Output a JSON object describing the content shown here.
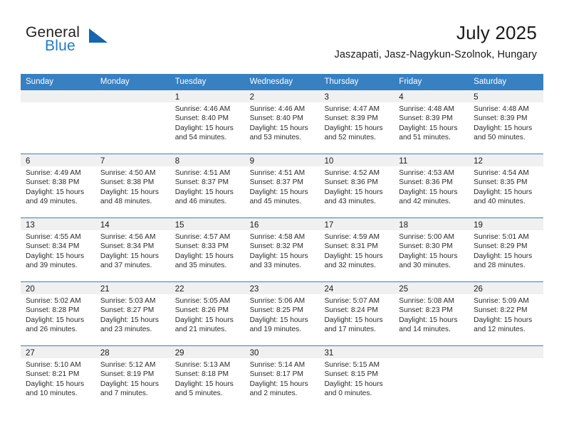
{
  "brand": {
    "name_part1": "General",
    "name_part2": "Blue",
    "triangle_color": "#1565b0",
    "blue_color": "#1f7ac4"
  },
  "header": {
    "title": "July 2025",
    "location": "Jaszapati, Jasz-Nagykun-Szolnok, Hungary"
  },
  "theme": {
    "header_blue": "#3780c2",
    "day_band_gray": "#f0f0f0",
    "text_color": "#2b2b2b"
  },
  "weekdays": [
    "Sunday",
    "Monday",
    "Tuesday",
    "Wednesday",
    "Thursday",
    "Friday",
    "Saturday"
  ],
  "weeks": [
    [
      {
        "day": "",
        "sunrise": "",
        "sunset": "",
        "daylight_line1": "",
        "daylight_line2": ""
      },
      {
        "day": "",
        "sunrise": "",
        "sunset": "",
        "daylight_line1": "",
        "daylight_line2": ""
      },
      {
        "day": "1",
        "sunrise": "Sunrise: 4:46 AM",
        "sunset": "Sunset: 8:40 PM",
        "daylight_line1": "Daylight: 15 hours",
        "daylight_line2": "and 54 minutes."
      },
      {
        "day": "2",
        "sunrise": "Sunrise: 4:46 AM",
        "sunset": "Sunset: 8:40 PM",
        "daylight_line1": "Daylight: 15 hours",
        "daylight_line2": "and 53 minutes."
      },
      {
        "day": "3",
        "sunrise": "Sunrise: 4:47 AM",
        "sunset": "Sunset: 8:39 PM",
        "daylight_line1": "Daylight: 15 hours",
        "daylight_line2": "and 52 minutes."
      },
      {
        "day": "4",
        "sunrise": "Sunrise: 4:48 AM",
        "sunset": "Sunset: 8:39 PM",
        "daylight_line1": "Daylight: 15 hours",
        "daylight_line2": "and 51 minutes."
      },
      {
        "day": "5",
        "sunrise": "Sunrise: 4:48 AM",
        "sunset": "Sunset: 8:39 PM",
        "daylight_line1": "Daylight: 15 hours",
        "daylight_line2": "and 50 minutes."
      }
    ],
    [
      {
        "day": "6",
        "sunrise": "Sunrise: 4:49 AM",
        "sunset": "Sunset: 8:38 PM",
        "daylight_line1": "Daylight: 15 hours",
        "daylight_line2": "and 49 minutes."
      },
      {
        "day": "7",
        "sunrise": "Sunrise: 4:50 AM",
        "sunset": "Sunset: 8:38 PM",
        "daylight_line1": "Daylight: 15 hours",
        "daylight_line2": "and 48 minutes."
      },
      {
        "day": "8",
        "sunrise": "Sunrise: 4:51 AM",
        "sunset": "Sunset: 8:37 PM",
        "daylight_line1": "Daylight: 15 hours",
        "daylight_line2": "and 46 minutes."
      },
      {
        "day": "9",
        "sunrise": "Sunrise: 4:51 AM",
        "sunset": "Sunset: 8:37 PM",
        "daylight_line1": "Daylight: 15 hours",
        "daylight_line2": "and 45 minutes."
      },
      {
        "day": "10",
        "sunrise": "Sunrise: 4:52 AM",
        "sunset": "Sunset: 8:36 PM",
        "daylight_line1": "Daylight: 15 hours",
        "daylight_line2": "and 43 minutes."
      },
      {
        "day": "11",
        "sunrise": "Sunrise: 4:53 AM",
        "sunset": "Sunset: 8:36 PM",
        "daylight_line1": "Daylight: 15 hours",
        "daylight_line2": "and 42 minutes."
      },
      {
        "day": "12",
        "sunrise": "Sunrise: 4:54 AM",
        "sunset": "Sunset: 8:35 PM",
        "daylight_line1": "Daylight: 15 hours",
        "daylight_line2": "and 40 minutes."
      }
    ],
    [
      {
        "day": "13",
        "sunrise": "Sunrise: 4:55 AM",
        "sunset": "Sunset: 8:34 PM",
        "daylight_line1": "Daylight: 15 hours",
        "daylight_line2": "and 39 minutes."
      },
      {
        "day": "14",
        "sunrise": "Sunrise: 4:56 AM",
        "sunset": "Sunset: 8:34 PM",
        "daylight_line1": "Daylight: 15 hours",
        "daylight_line2": "and 37 minutes."
      },
      {
        "day": "15",
        "sunrise": "Sunrise: 4:57 AM",
        "sunset": "Sunset: 8:33 PM",
        "daylight_line1": "Daylight: 15 hours",
        "daylight_line2": "and 35 minutes."
      },
      {
        "day": "16",
        "sunrise": "Sunrise: 4:58 AM",
        "sunset": "Sunset: 8:32 PM",
        "daylight_line1": "Daylight: 15 hours",
        "daylight_line2": "and 33 minutes."
      },
      {
        "day": "17",
        "sunrise": "Sunrise: 4:59 AM",
        "sunset": "Sunset: 8:31 PM",
        "daylight_line1": "Daylight: 15 hours",
        "daylight_line2": "and 32 minutes."
      },
      {
        "day": "18",
        "sunrise": "Sunrise: 5:00 AM",
        "sunset": "Sunset: 8:30 PM",
        "daylight_line1": "Daylight: 15 hours",
        "daylight_line2": "and 30 minutes."
      },
      {
        "day": "19",
        "sunrise": "Sunrise: 5:01 AM",
        "sunset": "Sunset: 8:29 PM",
        "daylight_line1": "Daylight: 15 hours",
        "daylight_line2": "and 28 minutes."
      }
    ],
    [
      {
        "day": "20",
        "sunrise": "Sunrise: 5:02 AM",
        "sunset": "Sunset: 8:28 PM",
        "daylight_line1": "Daylight: 15 hours",
        "daylight_line2": "and 26 minutes."
      },
      {
        "day": "21",
        "sunrise": "Sunrise: 5:03 AM",
        "sunset": "Sunset: 8:27 PM",
        "daylight_line1": "Daylight: 15 hours",
        "daylight_line2": "and 23 minutes."
      },
      {
        "day": "22",
        "sunrise": "Sunrise: 5:05 AM",
        "sunset": "Sunset: 8:26 PM",
        "daylight_line1": "Daylight: 15 hours",
        "daylight_line2": "and 21 minutes."
      },
      {
        "day": "23",
        "sunrise": "Sunrise: 5:06 AM",
        "sunset": "Sunset: 8:25 PM",
        "daylight_line1": "Daylight: 15 hours",
        "daylight_line2": "and 19 minutes."
      },
      {
        "day": "24",
        "sunrise": "Sunrise: 5:07 AM",
        "sunset": "Sunset: 8:24 PM",
        "daylight_line1": "Daylight: 15 hours",
        "daylight_line2": "and 17 minutes."
      },
      {
        "day": "25",
        "sunrise": "Sunrise: 5:08 AM",
        "sunset": "Sunset: 8:23 PM",
        "daylight_line1": "Daylight: 15 hours",
        "daylight_line2": "and 14 minutes."
      },
      {
        "day": "26",
        "sunrise": "Sunrise: 5:09 AM",
        "sunset": "Sunset: 8:22 PM",
        "daylight_line1": "Daylight: 15 hours",
        "daylight_line2": "and 12 minutes."
      }
    ],
    [
      {
        "day": "27",
        "sunrise": "Sunrise: 5:10 AM",
        "sunset": "Sunset: 8:21 PM",
        "daylight_line1": "Daylight: 15 hours",
        "daylight_line2": "and 10 minutes."
      },
      {
        "day": "28",
        "sunrise": "Sunrise: 5:12 AM",
        "sunset": "Sunset: 8:19 PM",
        "daylight_line1": "Daylight: 15 hours",
        "daylight_line2": "and 7 minutes."
      },
      {
        "day": "29",
        "sunrise": "Sunrise: 5:13 AM",
        "sunset": "Sunset: 8:18 PM",
        "daylight_line1": "Daylight: 15 hours",
        "daylight_line2": "and 5 minutes."
      },
      {
        "day": "30",
        "sunrise": "Sunrise: 5:14 AM",
        "sunset": "Sunset: 8:17 PM",
        "daylight_line1": "Daylight: 15 hours",
        "daylight_line2": "and 2 minutes."
      },
      {
        "day": "31",
        "sunrise": "Sunrise: 5:15 AM",
        "sunset": "Sunset: 8:15 PM",
        "daylight_line1": "Daylight: 15 hours",
        "daylight_line2": "and 0 minutes."
      },
      {
        "day": "",
        "sunrise": "",
        "sunset": "",
        "daylight_line1": "",
        "daylight_line2": ""
      },
      {
        "day": "",
        "sunrise": "",
        "sunset": "",
        "daylight_line1": "",
        "daylight_line2": ""
      }
    ]
  ]
}
